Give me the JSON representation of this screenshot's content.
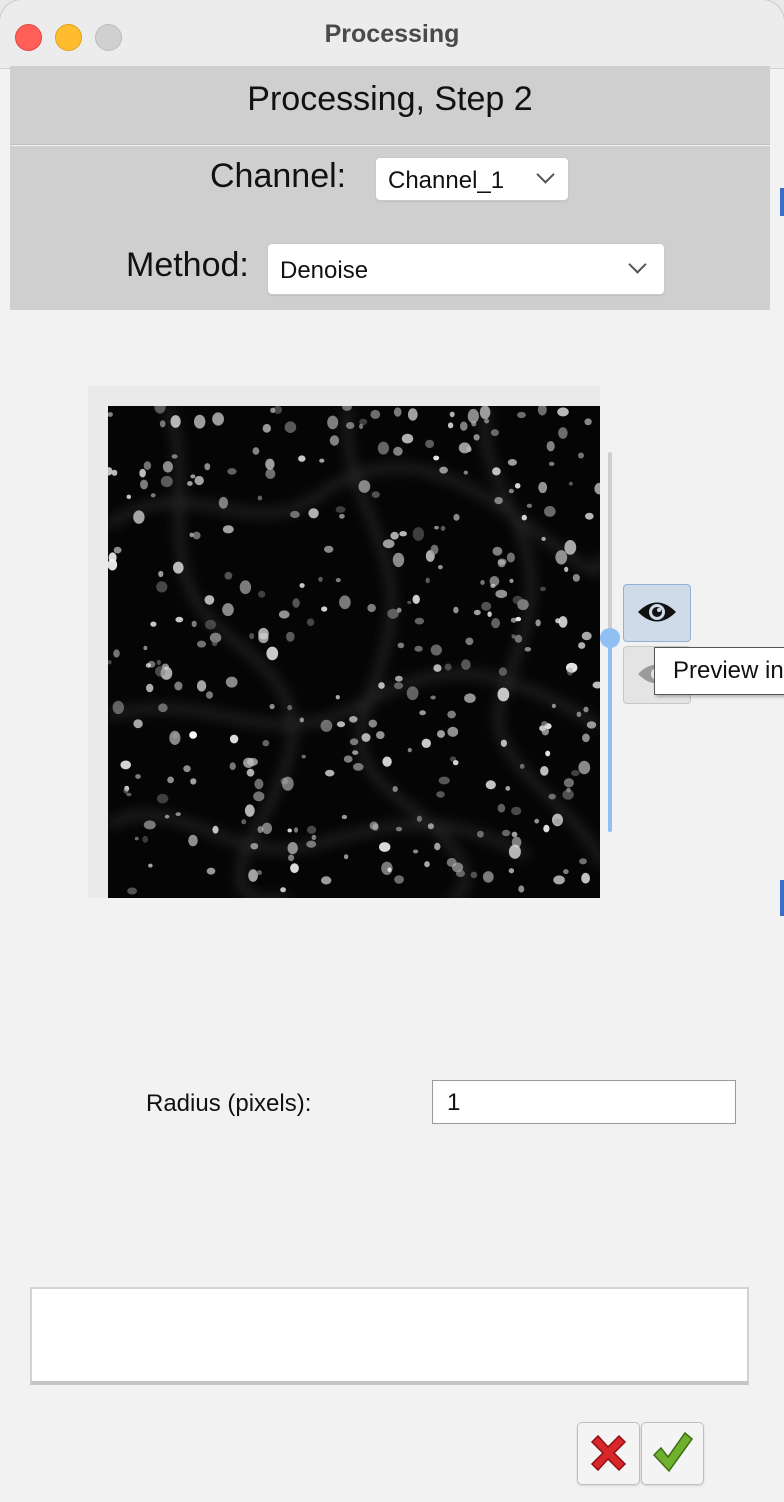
{
  "window": {
    "title": "Processing"
  },
  "header": {
    "title": "Processing, Step 2"
  },
  "form": {
    "channel_label": "Channel:",
    "channel_value": "Channel_1",
    "method_label": "Method:",
    "method_value": "Denoise"
  },
  "preview": {
    "tooltip": "Preview in",
    "preview_button_icon": "eye-icon",
    "hide_button_icon": "eye-slash-icon",
    "slider_level": 0.5
  },
  "parameters": {
    "radius_label": "Radius (pixels):",
    "radius_value": "1"
  },
  "log": {
    "text": ""
  },
  "actions": {
    "cancel_icon": "red-x-icon",
    "ok_icon": "green-check-icon"
  },
  "colors": {
    "accent": "#8fbff3",
    "panel": "#cfcfcf",
    "cancel": "#d9262b",
    "ok": "#6fb12d"
  }
}
